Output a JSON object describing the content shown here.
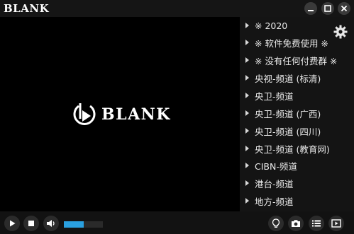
{
  "app": {
    "title": "BLANK",
    "logo_text": "BLANK"
  },
  "window_controls": [
    "minimize-icon",
    "maximize-icon",
    "close-icon"
  ],
  "playlist": {
    "items": [
      {
        "label": "※ 2020"
      },
      {
        "label": "※ 软件免费使用 ※"
      },
      {
        "label": "※ 没有任何付费群 ※"
      },
      {
        "label": "央视-频道 (标清)"
      },
      {
        "label": "央卫-频道"
      },
      {
        "label": "央卫-频道 (广西)"
      },
      {
        "label": "央卫-频道 (四川)"
      },
      {
        "label": "央卫-频道 (教育网)"
      },
      {
        "label": "CIBN-频道"
      },
      {
        "label": "港台-频道"
      },
      {
        "label": "地方-频道"
      }
    ]
  },
  "controls": {
    "volume_level": 0.5,
    "icons": [
      "play-icon",
      "stop-icon",
      "volume-icon",
      "lightbulb-icon",
      "camera-icon",
      "list-icon",
      "play-screen-icon"
    ]
  },
  "colors": {
    "accent": "#2aa0e0",
    "background": "#000000",
    "panel": "#141414"
  }
}
